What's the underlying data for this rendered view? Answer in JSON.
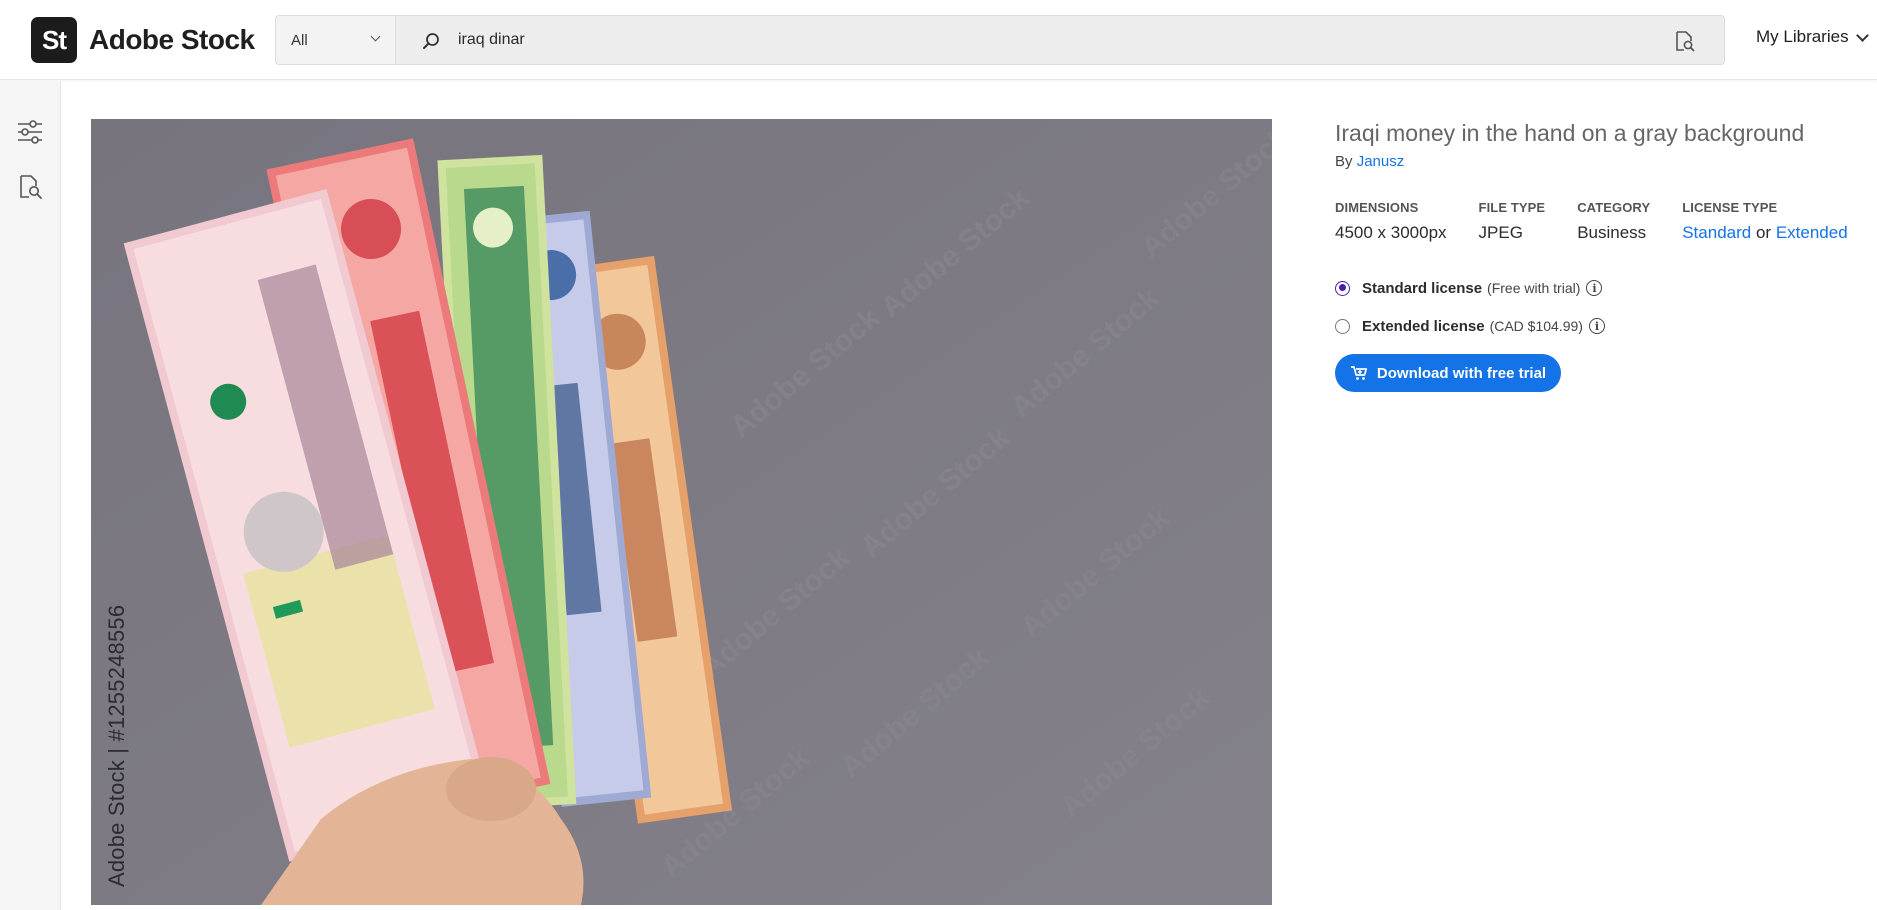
{
  "brand": {
    "logo_mark": "St",
    "name": "Adobe Stock"
  },
  "search": {
    "category": "All",
    "query": "iraq dinar",
    "search_icon": "search-icon",
    "visual_search_icon": "visual-search-icon"
  },
  "header": {
    "libraries_label": "My Libraries"
  },
  "rail": {
    "items": [
      "filters-icon",
      "visual-search-icon"
    ]
  },
  "image": {
    "watermark_text": "Adobe Stock",
    "stock_id": "Adobe Stock | #1255248556"
  },
  "asset": {
    "title": "Iraqi money in the hand on a gray background",
    "by_label": "By",
    "author": "Janusz",
    "dimensions_label": "DIMENSIONS",
    "dimensions": "4500 x 3000px",
    "file_type_label": "FILE TYPE",
    "file_type": "JPEG",
    "category_label": "CATEGORY",
    "category": "Business",
    "license_type_label": "LICENSE TYPE",
    "license_standard": "Standard",
    "license_or": "or",
    "license_extended": "Extended"
  },
  "licenses": [
    {
      "name": "Standard license",
      "price": "(Free with trial)",
      "selected": true
    },
    {
      "name": "Extended license",
      "price": "(CAD $104.99)",
      "selected": false
    }
  ],
  "cta": {
    "download_label": "Download with free trial",
    "icon": "cart-icon"
  },
  "colors": {
    "accent": "#1473e6",
    "radio": "#4b1ea8",
    "image_bg": "#7d7a84"
  }
}
